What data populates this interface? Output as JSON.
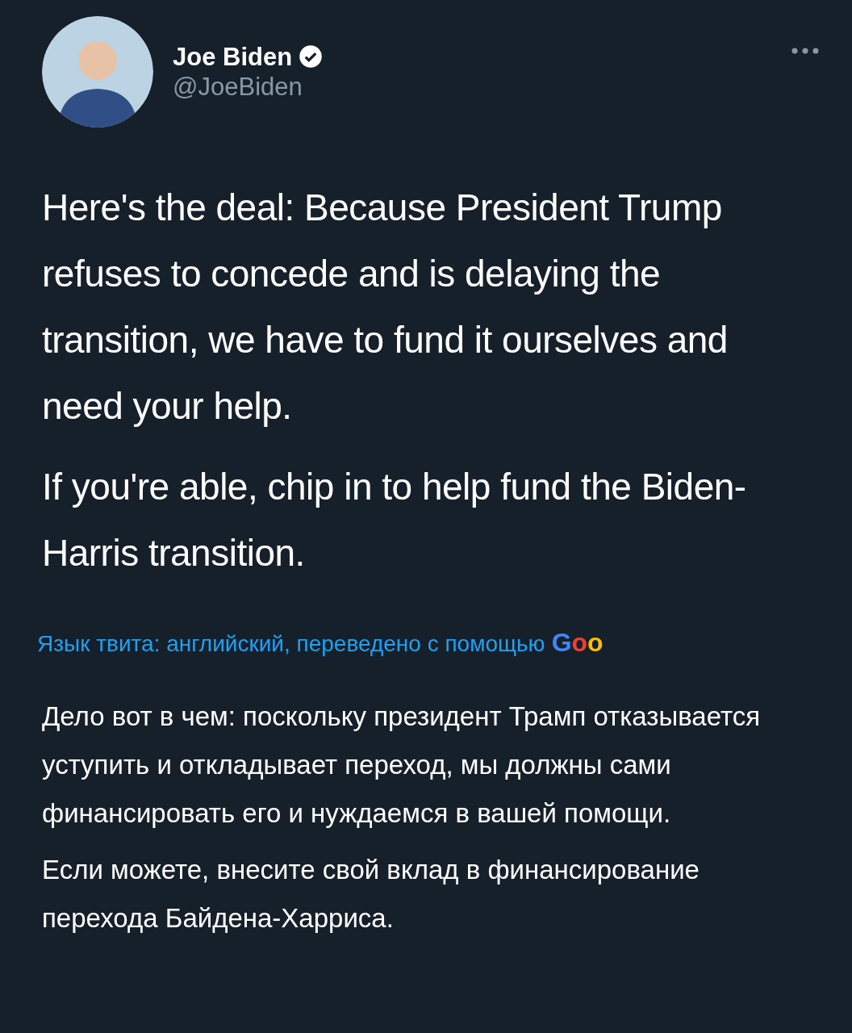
{
  "author": {
    "name": "Joe Biden",
    "verified": true,
    "handle": "@JoeBiden"
  },
  "tweet_text": [
    "Here's the deal: Because President Trump refuses to concede and is delaying the transition, we have to fund it ourselves and need your help.",
    "If you're able, chip in to help fund the Biden-Harris transition."
  ],
  "translation": {
    "note": "Язык твита: английский, переведено с помощью",
    "provider": "Goo"
  },
  "translated_text": [
    "Дело вот в чем: поскольку президент Трамп отказывается уступить и откладывает переход, мы должны сами финансировать его и нуждаемся в вашей помощи.",
    "Если можете, внесите свой вклад в финансирование перехода Байдена-Харриса."
  ]
}
